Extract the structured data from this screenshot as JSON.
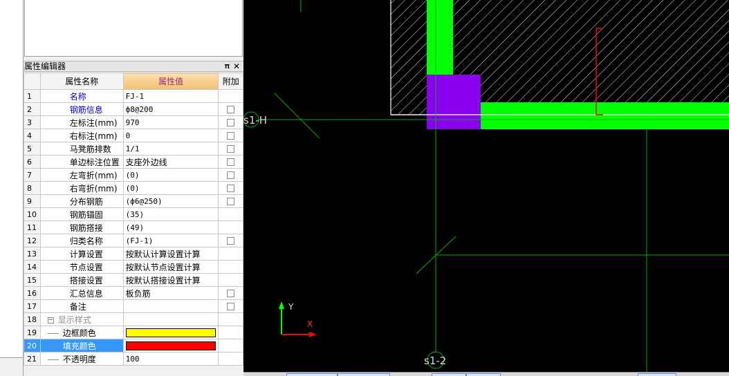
{
  "panel": {
    "title": "属性编辑器",
    "pin_glyph": "ᵖ",
    "close_glyph": "✕"
  },
  "columns": {
    "num": "",
    "name": "属性名称",
    "value": "属性值",
    "extra": "附加"
  },
  "rows": [
    {
      "n": "1",
      "name": "名称",
      "value": "FJ-1",
      "blue": true
    },
    {
      "n": "2",
      "name": "钢筋信息",
      "value": "ф8@200",
      "blue": true
    },
    {
      "n": "3",
      "name": "左标注(mm)",
      "value": "970"
    },
    {
      "n": "4",
      "name": "右标注(mm)",
      "value": "0"
    },
    {
      "n": "5",
      "name": "马凳筋排数",
      "value": "1/1"
    },
    {
      "n": "6",
      "name": "单边标注位置",
      "value": "支座外边线"
    },
    {
      "n": "7",
      "name": "左弯折(mm)",
      "value": "(0)"
    },
    {
      "n": "8",
      "name": "右弯折(mm)",
      "value": "(0)"
    },
    {
      "n": "9",
      "name": "分布钢筋",
      "value": "(ф6@250)"
    },
    {
      "n": "10",
      "name": "钢筋锚固",
      "value": "(35)"
    },
    {
      "n": "11",
      "name": "钢筋搭接",
      "value": "(49)"
    },
    {
      "n": "12",
      "name": "归类名称",
      "value": "(FJ-1)"
    },
    {
      "n": "13",
      "name": "计算设置",
      "value": "按默认计算设置计算"
    },
    {
      "n": "14",
      "name": "节点设置",
      "value": "按默认节点设置计算"
    },
    {
      "n": "15",
      "name": "搭接设置",
      "value": "按默认搭接设置计算"
    },
    {
      "n": "16",
      "name": "汇总信息",
      "value": "板负筋"
    },
    {
      "n": "17",
      "name": "备注",
      "value": ""
    },
    {
      "n": "18",
      "name": "显示样式",
      "value": ""
    },
    {
      "n": "19",
      "name": "边框颜色",
      "value": ""
    },
    {
      "n": "20",
      "name": "填充颜色",
      "value": ""
    },
    {
      "n": "21",
      "name": "不透明度",
      "value": "100"
    }
  ],
  "swatches": {
    "border_color": "#ffff00",
    "fill_color": "#ff0000"
  },
  "canvas": {
    "axis_h_label": "s1-H",
    "axis_v_label": "s1-2",
    "y_axis": "Y",
    "x_axis": "X",
    "colors": {
      "wall": "#00ff00",
      "column": "#8800ee",
      "rebar": "#ff0000",
      "axis": "#00b000"
    }
  }
}
